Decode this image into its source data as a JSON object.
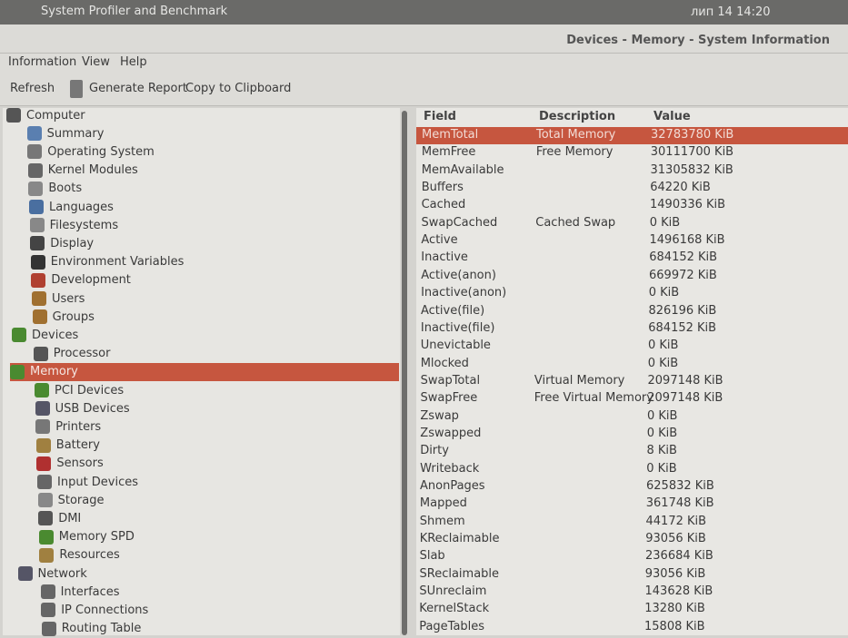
{
  "topbar": {
    "app_title": "System Profiler and Benchmark",
    "clock": "лип 14  14:20"
  },
  "window": {
    "title": "Devices - Memory - System Information"
  },
  "menu": [
    "Information",
    "View",
    "Help"
  ],
  "toolbar": {
    "refresh": "Refresh",
    "generate_report": "Generate Report",
    "copy": "Copy to Clipboard"
  },
  "tree": [
    {
      "label": "Computer",
      "level": 0,
      "icon": "computer-icon",
      "color": "#555"
    },
    {
      "label": "Summary",
      "level": 1,
      "icon": "info-icon",
      "color": "#5a7fb0"
    },
    {
      "label": "Operating System",
      "level": 1,
      "icon": "gear-icon",
      "color": "#777"
    },
    {
      "label": "Kernel Modules",
      "level": 1,
      "icon": "module-icon",
      "color": "#666"
    },
    {
      "label": "Boots",
      "level": 1,
      "icon": "power-icon",
      "color": "#888"
    },
    {
      "label": "Languages",
      "level": 1,
      "icon": "flag-icon",
      "color": "#4a6fa0"
    },
    {
      "label": "Filesystems",
      "level": 1,
      "icon": "drive-icon",
      "color": "#888"
    },
    {
      "label": "Display",
      "level": 1,
      "icon": "monitor-icon",
      "color": "#444"
    },
    {
      "label": "Environment Variables",
      "level": 1,
      "icon": "terminal-icon",
      "color": "#333"
    },
    {
      "label": "Development",
      "level": 1,
      "icon": "tools-icon",
      "color": "#b04030"
    },
    {
      "label": "Users",
      "level": 1,
      "icon": "user-icon",
      "color": "#a07030"
    },
    {
      "label": "Groups",
      "level": 1,
      "icon": "group-icon",
      "color": "#a07030"
    },
    {
      "label": "Devices",
      "level": 0,
      "icon": "board-icon",
      "color": "#4a8a30"
    },
    {
      "label": "Processor",
      "level": 1,
      "icon": "cpu-icon",
      "color": "#555"
    },
    {
      "label": "Memory",
      "level": 1,
      "icon": "memory-icon",
      "color": "#4a8a30",
      "selected": true
    },
    {
      "label": "PCI Devices",
      "level": 1,
      "icon": "pci-icon",
      "color": "#4a8a30"
    },
    {
      "label": "USB Devices",
      "level": 1,
      "icon": "usb-icon",
      "color": "#556"
    },
    {
      "label": "Printers",
      "level": 1,
      "icon": "printer-icon",
      "color": "#777"
    },
    {
      "label": "Battery",
      "level": 1,
      "icon": "battery-icon",
      "color": "#a08040"
    },
    {
      "label": "Sensors",
      "level": 1,
      "icon": "thermometer-icon",
      "color": "#b03030"
    },
    {
      "label": "Input Devices",
      "level": 1,
      "icon": "keyboard-icon",
      "color": "#666"
    },
    {
      "label": "Storage",
      "level": 1,
      "icon": "storage-icon",
      "color": "#888"
    },
    {
      "label": "DMI",
      "level": 1,
      "icon": "dmi-icon",
      "color": "#555"
    },
    {
      "label": "Memory SPD",
      "level": 1,
      "icon": "memory-icon",
      "color": "#4a8a30"
    },
    {
      "label": "Resources",
      "level": 1,
      "icon": "resources-icon",
      "color": "#a08040"
    },
    {
      "label": "Network",
      "level": 0,
      "icon": "network-icon",
      "color": "#556"
    },
    {
      "label": "Interfaces",
      "level": 1,
      "icon": "interfaces-icon",
      "color": "#666"
    },
    {
      "label": "IP Connections",
      "level": 1,
      "icon": "connections-icon",
      "color": "#666"
    },
    {
      "label": "Routing Table",
      "level": 1,
      "icon": "routing-icon",
      "color": "#666"
    }
  ],
  "table": {
    "headers": [
      "Field",
      "Description",
      "Value"
    ],
    "rows": [
      [
        "MemTotal",
        "Total Memory",
        "32783780 KiB"
      ],
      [
        "MemFree",
        "Free Memory",
        "30111700 KiB"
      ],
      [
        "MemAvailable",
        "",
        "31305832 KiB"
      ],
      [
        "Buffers",
        "",
        "64220 KiB"
      ],
      [
        "Cached",
        "",
        "1490336 KiB"
      ],
      [
        "SwapCached",
        "Cached Swap",
        "0 KiB"
      ],
      [
        "Active",
        "",
        "1496168 KiB"
      ],
      [
        "Inactive",
        "",
        "684152 KiB"
      ],
      [
        "Active(anon)",
        "",
        "669972 KiB"
      ],
      [
        "Inactive(anon)",
        "",
        "0 KiB"
      ],
      [
        "Active(file)",
        "",
        "826196 KiB"
      ],
      [
        "Inactive(file)",
        "",
        "684152 KiB"
      ],
      [
        "Unevictable",
        "",
        "0 KiB"
      ],
      [
        "Mlocked",
        "",
        "0 KiB"
      ],
      [
        "SwapTotal",
        "Virtual Memory",
        "2097148 KiB"
      ],
      [
        "SwapFree",
        "Free Virtual Memory",
        "2097148 KiB"
      ],
      [
        "Zswap",
        "",
        "0 KiB"
      ],
      [
        "Zswapped",
        "",
        "0 KiB"
      ],
      [
        "Dirty",
        "",
        "8 KiB"
      ],
      [
        "Writeback",
        "",
        "0 KiB"
      ],
      [
        "AnonPages",
        "",
        "625832 KiB"
      ],
      [
        "Mapped",
        "",
        "361748 KiB"
      ],
      [
        "Shmem",
        "",
        "44172 KiB"
      ],
      [
        "KReclaimable",
        "",
        "93056 KiB"
      ],
      [
        "Slab",
        "",
        "236684 KiB"
      ],
      [
        "SReclaimable",
        "",
        "93056 KiB"
      ],
      [
        "SUnreclaim",
        "",
        "143628 KiB"
      ],
      [
        "KernelStack",
        "",
        "13280 KiB"
      ],
      [
        "PageTables",
        "",
        "15808 KiB"
      ]
    ]
  }
}
